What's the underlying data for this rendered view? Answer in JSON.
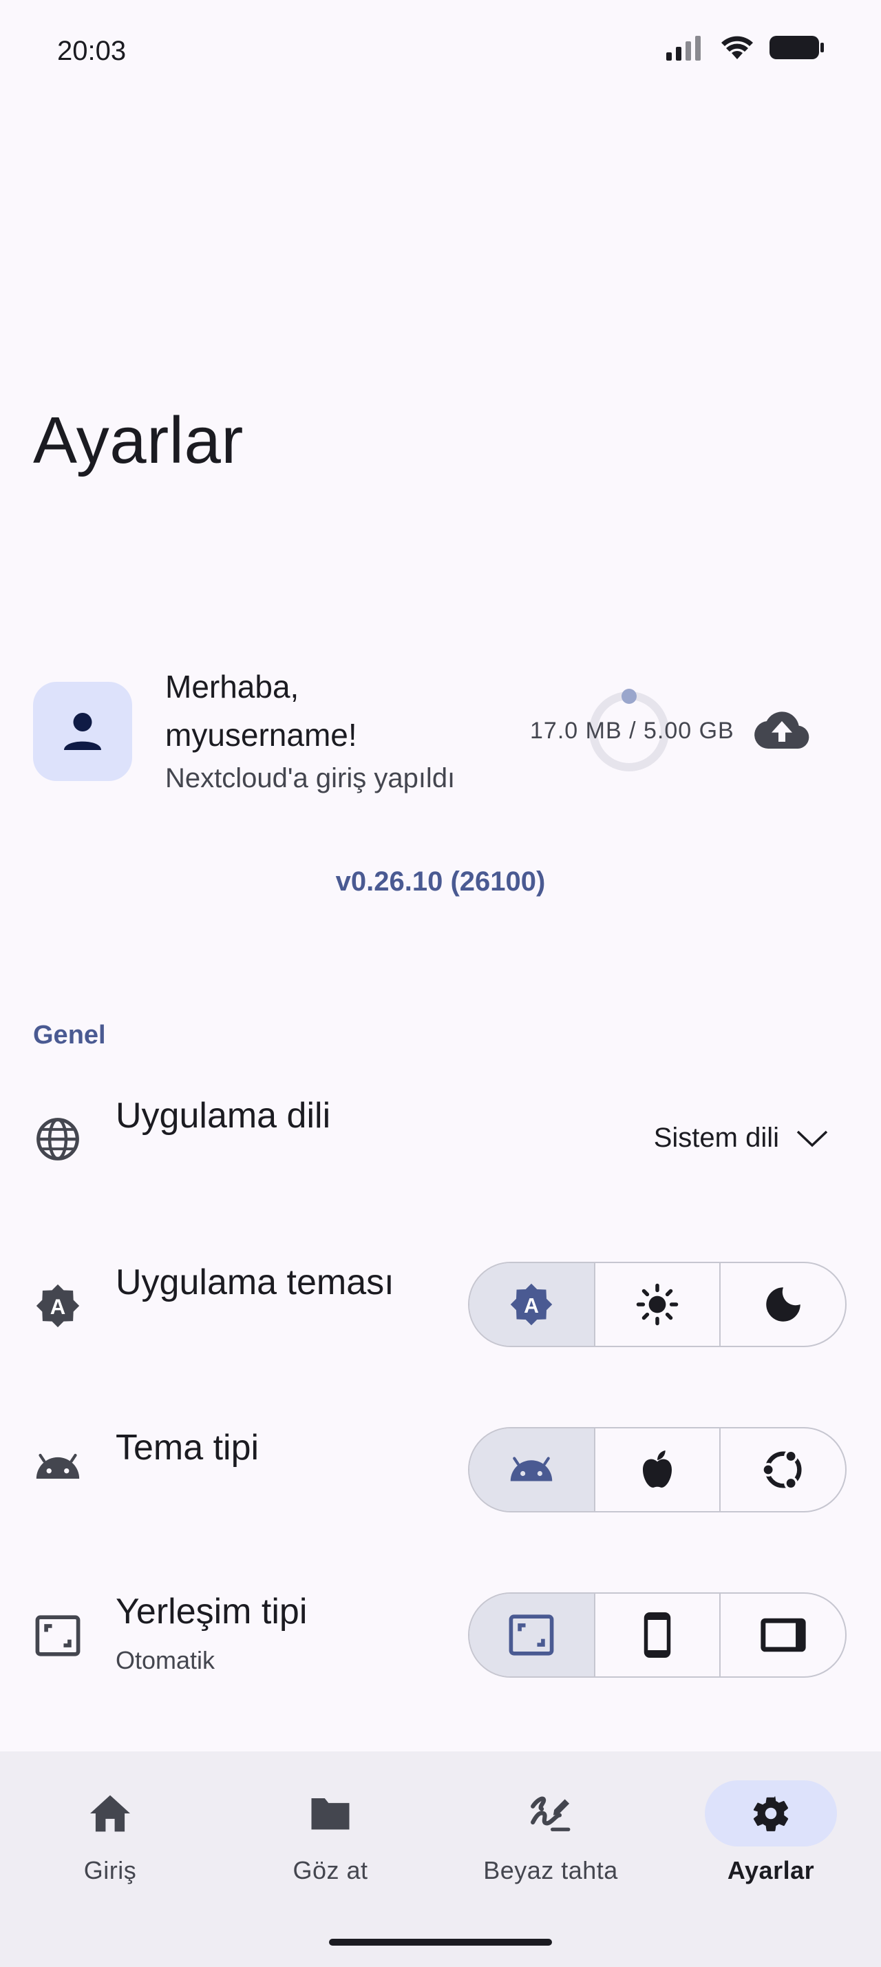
{
  "status_bar": {
    "time": "20:03"
  },
  "page": {
    "title": "Ayarlar"
  },
  "account": {
    "greeting": "Merhaba, myusername!",
    "subtitle": "Nextcloud'a giriş yapıldı",
    "storage_text": "17.0 MB / 5.00 GB",
    "storage_used_fraction": 0.0034
  },
  "version": "v0.26.10 (26100)",
  "general": {
    "section_title": "Genel",
    "language": {
      "title": "Uygulama dili",
      "value": "Sistem dili"
    },
    "theme": {
      "title": "Uygulama teması",
      "options": [
        "auto-theme-icon",
        "light-icon",
        "dark-icon"
      ],
      "selected": 0
    },
    "theme_type": {
      "title": "Tema tipi",
      "options": [
        "android-icon",
        "apple-icon",
        "ubuntu-icon"
      ],
      "selected": 0
    },
    "layout_type": {
      "title": "Yerleşim tipi",
      "subtitle": "Otomatik",
      "options": [
        "auto-layout-icon",
        "phone-icon",
        "tablet-icon"
      ],
      "selected": 0
    }
  },
  "nav": {
    "items": [
      {
        "label": "Giriş",
        "icon": "home-icon"
      },
      {
        "label": "Göz at",
        "icon": "folder-icon"
      },
      {
        "label": "Beyaz tahta",
        "icon": "whiteboard-icon"
      },
      {
        "label": "Ayarlar",
        "icon": "gear-icon"
      }
    ],
    "active": 3
  },
  "colors": {
    "accent": "#4a5a92",
    "selected_bg": "#e1e2ec",
    "avatar_bg": "#dde2fb"
  }
}
